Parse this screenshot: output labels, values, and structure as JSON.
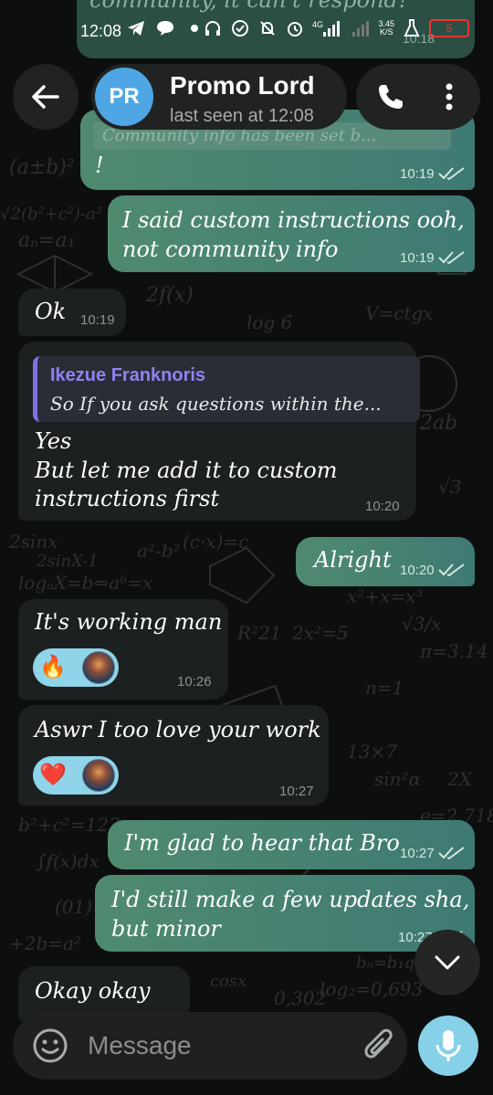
{
  "status_bar": {
    "time": "12:08",
    "net_speed_value": "3.45",
    "net_speed_unit": "K/S",
    "network": "4G",
    "battery": "5",
    "battery_color": "#e33333"
  },
  "background_partial_message": {
    "text": "community, it can't respond?",
    "time": "10:18"
  },
  "header": {
    "avatar_initials": "PR",
    "avatar_color": "#4fa6e4",
    "chat_name": "Promo Lord",
    "chat_status": "last seen at 12:08"
  },
  "messages": [
    {
      "direction": "out",
      "quoted_partial": "Community info has been set b...",
      "text": "!",
      "time": "10:19",
      "read": true
    },
    {
      "direction": "out",
      "text_line1": "I said custom instructions ooh,",
      "text_line2": "not community info",
      "time": "10:19",
      "read": true
    },
    {
      "direction": "in",
      "text": "Ok",
      "time": "10:19"
    },
    {
      "direction": "in",
      "reply_to_name": "Ikezue Franknoris",
      "reply_to_text": "So If you ask questions within the...",
      "text_line1": "Yes",
      "text_line2": "But let me add it to custom",
      "text_line3": "instructions first",
      "time": "10:20"
    },
    {
      "direction": "out",
      "text": "Alright",
      "time": "10:20",
      "read": true
    },
    {
      "direction": "in",
      "text": "It's working man",
      "reaction": "🔥",
      "time": "10:26"
    },
    {
      "direction": "in",
      "text": "Aswr I too love your work",
      "reaction": "❤️",
      "time": "10:27"
    },
    {
      "direction": "out",
      "text": "I'm glad to hear that Bro",
      "time": "10:27",
      "read": true
    },
    {
      "direction": "out",
      "text_line1": "I'd still make a few updates sha,",
      "text_line2": "but minor",
      "time": "10:27",
      "read": true
    },
    {
      "direction": "in",
      "text": "Okay okay"
    }
  ],
  "composer": {
    "placeholder": "Message"
  },
  "colors": {
    "outgoing_bubble": "#4f8a6f",
    "incoming_bubble": "#1d2020",
    "reply_accent": "#7e73e6",
    "mic_button": "#86d0e8",
    "reaction_pill": "#8fd4e9"
  },
  "icons": {
    "back": "arrow-left-icon",
    "call": "phone-icon",
    "menu": "more-vertical-icon",
    "scroll": "chevron-down-icon",
    "emoji": "smiley-icon",
    "attach": "paperclip-icon",
    "mic": "microphone-icon",
    "read_receipt": "double-check-icon"
  }
}
